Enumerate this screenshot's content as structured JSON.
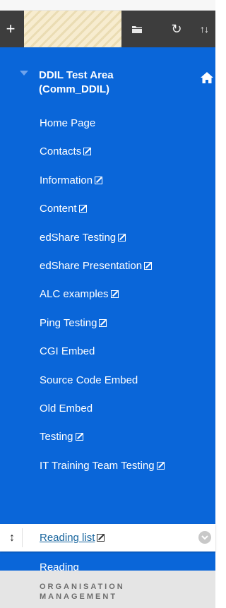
{
  "toolbar": {
    "add_icon": "plus-icon",
    "folder_icon": "folder-icon",
    "refresh_icon": "refresh-icon",
    "sort_icon": "sort-icon"
  },
  "course": {
    "title": "DDIL Test Area (Comm_DDIL)",
    "home_icon": "home-icon"
  },
  "menu_items": [
    {
      "label": "Home Page",
      "hidden": false
    },
    {
      "label": "Contacts",
      "hidden": true
    },
    {
      "label": "Information",
      "hidden": true
    },
    {
      "label": "Content",
      "hidden": true
    },
    {
      "label": "edShare Testing",
      "hidden": true
    },
    {
      "label": "edShare Presentation",
      "hidden": true
    },
    {
      "label": "ALC examples",
      "hidden": true
    },
    {
      "label": "Ping Testing",
      "hidden": true
    },
    {
      "label": "CGI Embed",
      "hidden": false
    },
    {
      "label": "Source Code Embed",
      "hidden": false
    },
    {
      "label": "Old Embed",
      "hidden": false
    },
    {
      "label": "Testing",
      "hidden": true
    },
    {
      "label": "IT Training Team Testing",
      "hidden": true
    }
  ],
  "selected_item": {
    "label": "Reading list",
    "hidden": true
  },
  "after_items": [
    {
      "label": "Reading"
    }
  ],
  "bottom_section": {
    "heading": "ORGANISATION MANAGEMENT"
  },
  "colors": {
    "nav_blue": "#0a66d9",
    "toolbar": "#3d3d3d",
    "link": "#17659e"
  }
}
